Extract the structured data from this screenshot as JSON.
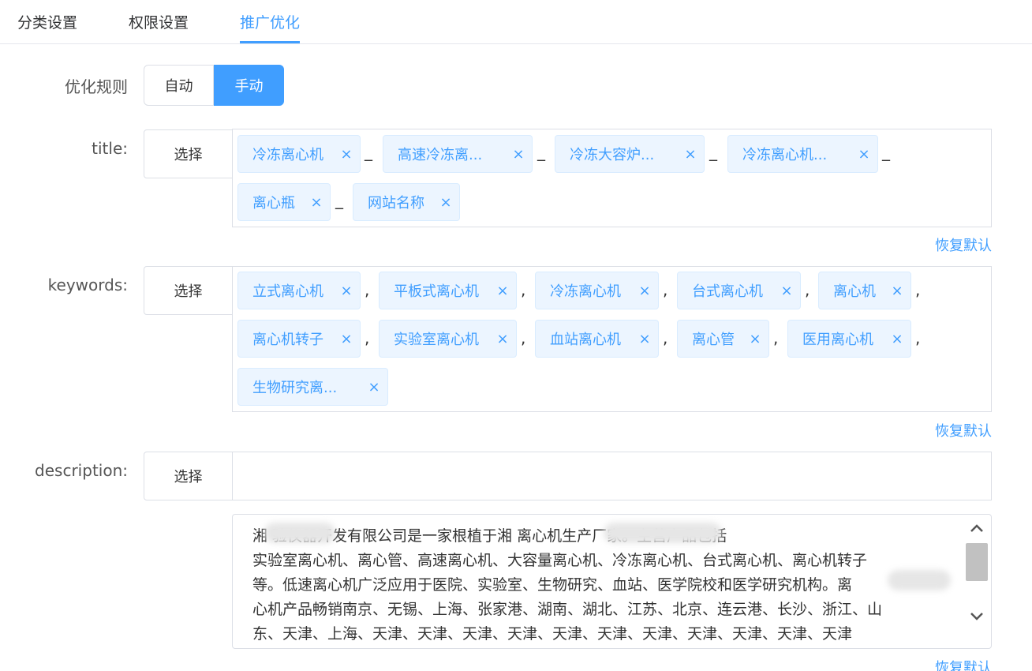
{
  "tabs": [
    {
      "label": "分类设置"
    },
    {
      "label": "权限设置"
    },
    {
      "label": "推广优化"
    }
  ],
  "rule": {
    "label": "优化规则",
    "options": [
      "自动",
      "手动"
    ],
    "selected": "手动"
  },
  "title": {
    "label": "title:",
    "select_label": "选择",
    "tags": [
      "冷冻离心机",
      "高速冷冻离...",
      "冷冻大容炉...",
      "冷冻离心机...",
      "离心瓶",
      "网站名称"
    ],
    "separator": "_",
    "restore_label": "恢复默认"
  },
  "keywords": {
    "label": "keywords:",
    "select_label": "选择",
    "tags": [
      "立式离心机",
      "平板式离心机",
      "冷冻离心机",
      "台式离心机",
      "离心机",
      "离心机转子",
      "实验室离心机",
      "血站离心机",
      "离心管",
      "医用离心机",
      "生物研究离..."
    ],
    "separator": ",",
    "restore_label": "恢复默认"
  },
  "description": {
    "label": "description:",
    "select_label": "选择",
    "text_lines": [
      "湘 验仪器开发有限公司是一家根植于湘 离心机生产厂家。主营产品包括",
      "实验室离心机、离心管、高速离心机、大容量离心机、冷冻离心机、台式离心机、离心机转子",
      "等。低速离心机广泛应用于医院、实验室、生物研究、血站、医学院校和医学研究机构。离",
      "心机产品畅销南京、无锡、上海、张家港、湖南、湖北、江苏、北京、连云港、长沙、浙江、山",
      "东、天津、上海、天津、天津、天津、天津、天津、天津、天津、天津、天津、天津、天津"
    ],
    "restore_label": "恢复默认"
  },
  "icons": {
    "close": "×",
    "scroll_up": "chevron-up-icon",
    "scroll_down": "chevron-down-icon"
  },
  "colors": {
    "accent": "#409eff",
    "tag_bg": "#ecf5ff",
    "border": "#dcdfe6"
  }
}
